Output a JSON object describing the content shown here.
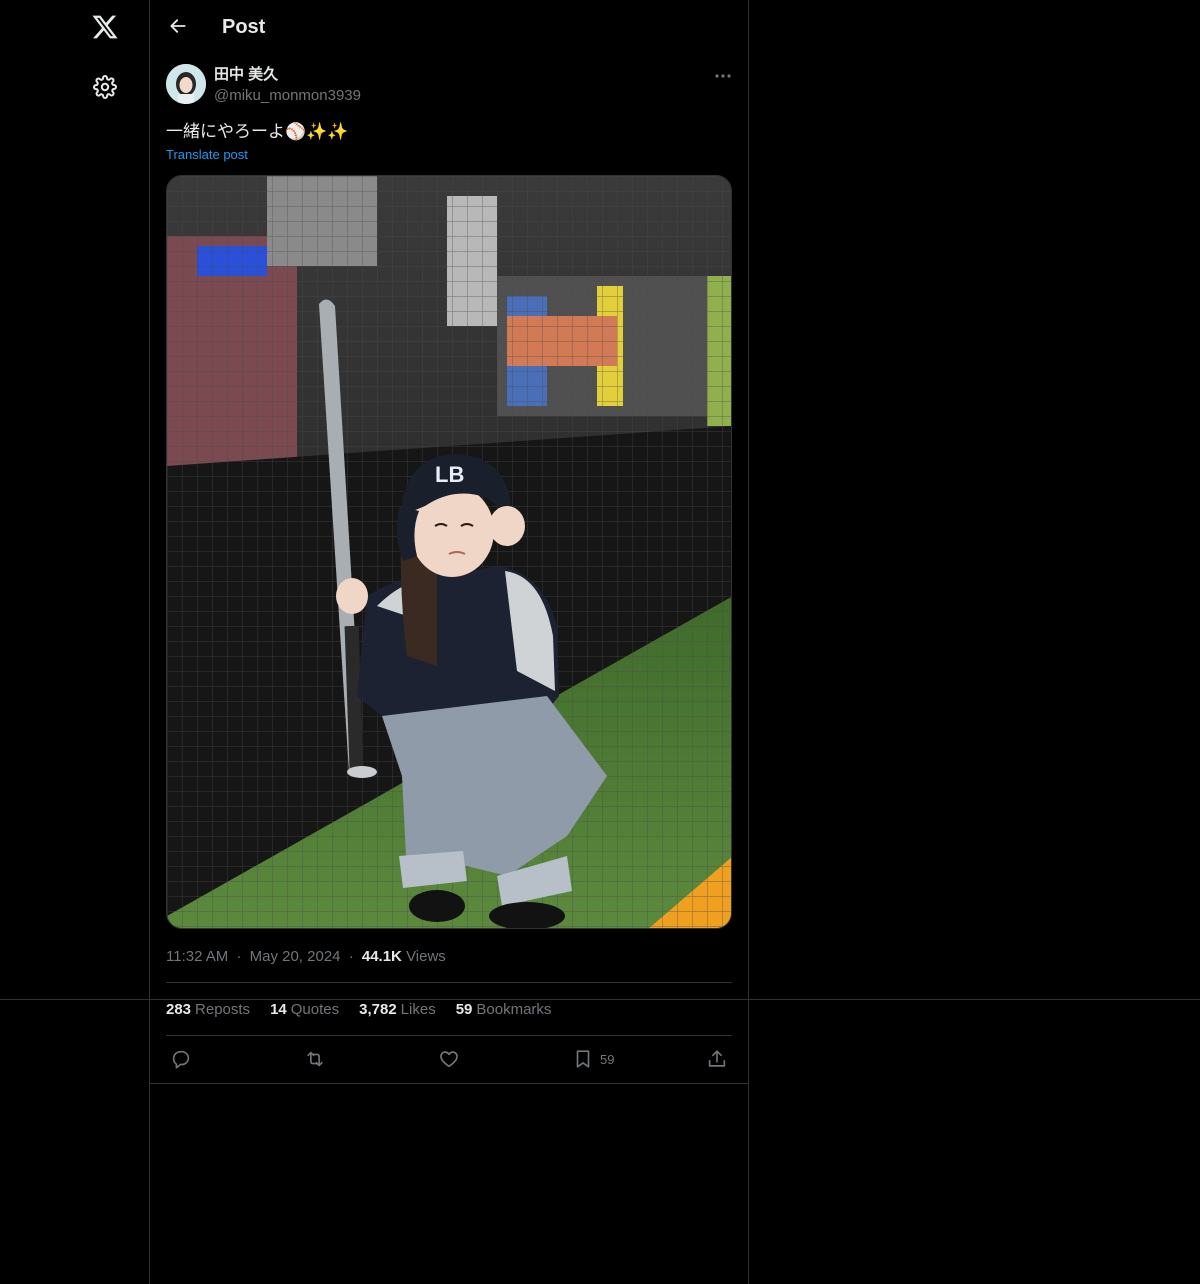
{
  "header": {
    "title": "Post"
  },
  "author": {
    "display_name": "田中 美久",
    "handle": "@miku_monmon3939"
  },
  "post": {
    "text": "一緒にやろーよ",
    "emojis": [
      "⚾",
      "✨",
      "✨"
    ],
    "translate_label": "Translate post"
  },
  "meta": {
    "time": "11:32 AM",
    "date": "May 20, 2024",
    "views_count": "44.1K",
    "views_label": "Views"
  },
  "stats": {
    "reposts": {
      "count": "283",
      "label": "Reposts"
    },
    "quotes": {
      "count": "14",
      "label": "Quotes"
    },
    "likes": {
      "count": "3,782",
      "label": "Likes"
    },
    "bookmarks": {
      "count": "59",
      "label": "Bookmarks"
    }
  },
  "actions": {
    "bookmark_count": "59"
  },
  "icons": {
    "logo": "x-logo-icon",
    "settings": "gear-icon",
    "back": "arrow-left-icon",
    "more": "more-horizontal-icon",
    "reply": "reply-icon",
    "repost": "repost-icon",
    "like": "heart-icon",
    "bookmark": "bookmark-icon",
    "share": "share-icon"
  },
  "colors": {
    "background": "#000000",
    "text_primary": "#e7e9ea",
    "text_secondary": "#71767b",
    "link": "#1d9bf0",
    "border": "#2f3336"
  }
}
